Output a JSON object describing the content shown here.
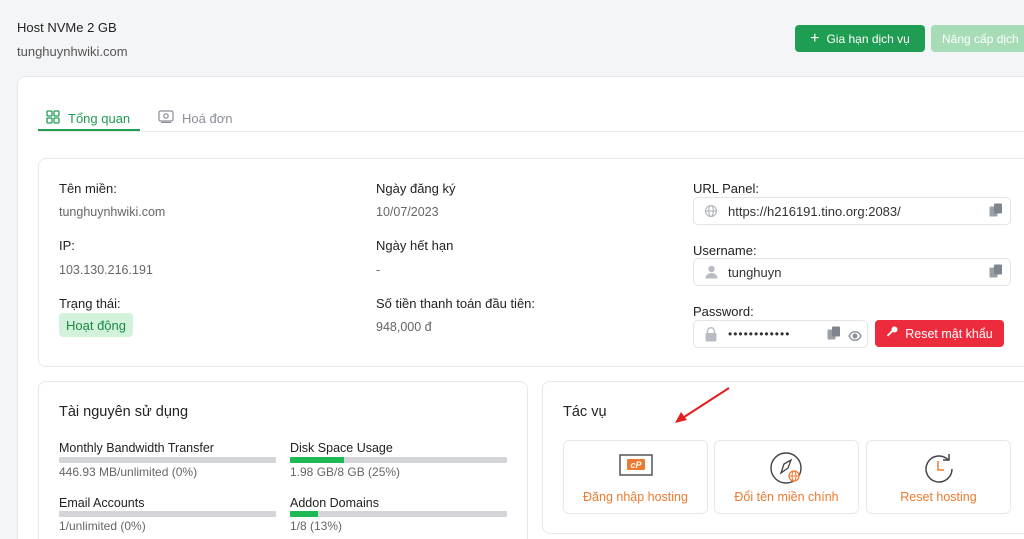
{
  "header": {
    "title": "Host NVMe 2 GB",
    "domain": "tunghuynhwiki.com",
    "renew_label": "Gia hạn dịch vụ",
    "upgrade_label": "Nâng cấp dịch"
  },
  "tabs": [
    {
      "label": "Tổng quan",
      "active": true
    },
    {
      "label": "Hoá đơn",
      "active": false
    }
  ],
  "info": {
    "domain_label": "Tên miền:",
    "domain_value": "tunghuynhwiki.com",
    "ip_label": "IP:",
    "ip_value": "103.130.216.191",
    "status_label": "Trạng thái:",
    "status_value": "Hoạt động",
    "reg_date_label": "Ngày đăng ký",
    "reg_date_value": "10/07/2023",
    "exp_date_label": "Ngày hết hạn",
    "exp_date_value": "-",
    "first_payment_label": "Số tiền thanh toán đầu tiên:",
    "first_payment_value": "948,000 đ",
    "url_panel_label": "URL Panel:",
    "url_panel_value": "https://h216191.tino.org:2083/",
    "username_label": "Username:",
    "username_value": "tunghuyn",
    "password_label": "Password:",
    "password_value": "••••••••••••",
    "reset_password_label": "Reset mật khẩu"
  },
  "resources": {
    "title": "Tài nguyên sử dụng",
    "items": [
      {
        "label": "Monthly Bandwidth Transfer",
        "value": "446.93 MB/unlimited (0%)",
        "percent": 0
      },
      {
        "label": "Disk Space Usage",
        "value": "1.98 GB/8 GB (25%)",
        "percent": 25
      },
      {
        "label": "Email Accounts",
        "value": "1/unlimited (0%)",
        "percent": 0
      },
      {
        "label": "Addon Domains",
        "value": "1/8 (13%)",
        "percent": 13
      }
    ]
  },
  "actions": {
    "title": "Tác vụ",
    "items": [
      {
        "label": "Đăng nhập hosting",
        "icon": "cpanel-icon"
      },
      {
        "label": "Đổi tên miền chính",
        "icon": "rocket-globe-icon"
      },
      {
        "label": "Reset hosting",
        "icon": "reset-clock-icon"
      }
    ]
  },
  "colors": {
    "primary_green": "#1f9d52",
    "danger_red": "#ec2b3c",
    "action_orange": "#ee7a2f",
    "bar_fill": "#1db954"
  }
}
